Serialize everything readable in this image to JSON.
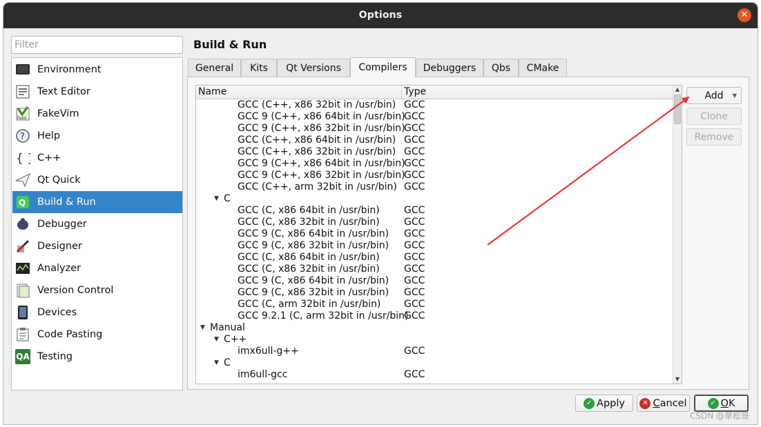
{
  "window": {
    "title": "Options",
    "close_glyph": "✕"
  },
  "filter": {
    "placeholder": "Filter",
    "value": ""
  },
  "sidebar": {
    "items": [
      {
        "label": "Environment",
        "icon": "monitor-icon",
        "active": false
      },
      {
        "label": "Text Editor",
        "icon": "text-editor-icon",
        "active": false
      },
      {
        "label": "FakeVim",
        "icon": "fakevim-icon",
        "active": false
      },
      {
        "label": "Help",
        "icon": "help-icon",
        "active": false
      },
      {
        "label": "C++",
        "icon": "cpp-braces-icon",
        "active": false
      },
      {
        "label": "Qt Quick",
        "icon": "paper-plane-icon",
        "active": false
      },
      {
        "label": "Build & Run",
        "icon": "qt-build-icon",
        "active": true
      },
      {
        "label": "Debugger",
        "icon": "bug-icon",
        "active": false
      },
      {
        "label": "Designer",
        "icon": "designer-icon",
        "active": false
      },
      {
        "label": "Analyzer",
        "icon": "analyzer-icon",
        "active": false
      },
      {
        "label": "Version Control",
        "icon": "version-control-icon",
        "active": false
      },
      {
        "label": "Devices",
        "icon": "device-icon",
        "active": false
      },
      {
        "label": "Code Pasting",
        "icon": "code-pasting-icon",
        "active": false
      },
      {
        "label": "Testing",
        "icon": "qa-icon",
        "icon_text": "QA",
        "active": false
      }
    ]
  },
  "page": {
    "title": "Build & Run"
  },
  "tabs": [
    {
      "label": "General",
      "active": false
    },
    {
      "label": "Kits",
      "active": false
    },
    {
      "label": "Qt Versions",
      "active": false
    },
    {
      "label": "Compilers",
      "active": true
    },
    {
      "label": "Debuggers",
      "active": false
    },
    {
      "label": "Qbs",
      "active": false
    },
    {
      "label": "CMake",
      "active": false
    }
  ],
  "tree": {
    "columns": {
      "name": "Name",
      "type": "Type"
    },
    "rows": [
      {
        "name": "GCC (C++, x86 32bit in /usr/bin)",
        "type": "GCC",
        "level": 2
      },
      {
        "name": "GCC 9 (C++, x86 64bit in /usr/bin)",
        "type": "GCC",
        "level": 2
      },
      {
        "name": "GCC 9 (C++, x86 32bit in /usr/bin)",
        "type": "GCC",
        "level": 2
      },
      {
        "name": "GCC (C++, x86 64bit in /usr/bin)",
        "type": "GCC",
        "level": 2
      },
      {
        "name": "GCC (C++, x86 32bit in /usr/bin)",
        "type": "GCC",
        "level": 2
      },
      {
        "name": "GCC 9 (C++, x86 64bit in /usr/bin)",
        "type": "GCC",
        "level": 2
      },
      {
        "name": "GCC 9 (C++, x86 32bit in /usr/bin)",
        "type": "GCC",
        "level": 2
      },
      {
        "name": "GCC (C++, arm 32bit in /usr/bin)",
        "type": "GCC",
        "level": 2
      },
      {
        "name": "C",
        "type": "",
        "level": 1,
        "expanded": true
      },
      {
        "name": "GCC (C, x86 64bit in /usr/bin)",
        "type": "GCC",
        "level": 2
      },
      {
        "name": "GCC (C, x86 32bit in /usr/bin)",
        "type": "GCC",
        "level": 2
      },
      {
        "name": "GCC 9 (C, x86 64bit in /usr/bin)",
        "type": "GCC",
        "level": 2
      },
      {
        "name": "GCC 9 (C, x86 32bit in /usr/bin)",
        "type": "GCC",
        "level": 2
      },
      {
        "name": "GCC (C, x86 64bit in /usr/bin)",
        "type": "GCC",
        "level": 2
      },
      {
        "name": "GCC (C, x86 32bit in /usr/bin)",
        "type": "GCC",
        "level": 2
      },
      {
        "name": "GCC 9 (C, x86 64bit in /usr/bin)",
        "type": "GCC",
        "level": 2
      },
      {
        "name": "GCC 9 (C, x86 32bit in /usr/bin)",
        "type": "GCC",
        "level": 2
      },
      {
        "name": "GCC (C, arm 32bit in /usr/bin)",
        "type": "GCC",
        "level": 2
      },
      {
        "name": "GCC 9.2.1 (C, arm 32bit in /usr/bin)",
        "type": "GCC",
        "level": 2
      },
      {
        "name": "Manual",
        "type": "",
        "level": 0,
        "expanded": true
      },
      {
        "name": "C++",
        "type": "",
        "level": 1,
        "expanded": true
      },
      {
        "name": "imx6ull-g++",
        "type": "GCC",
        "level": 2
      },
      {
        "name": "C",
        "type": "",
        "level": 1,
        "expanded": true
      },
      {
        "name": "im6ull-gcc",
        "type": "GCC",
        "level": 2
      }
    ]
  },
  "side_buttons": {
    "add": {
      "label": "Add",
      "enabled": true
    },
    "clone": {
      "label": "Clone",
      "enabled": false
    },
    "remove": {
      "label": "Remove",
      "enabled": false
    }
  },
  "dialog_buttons": {
    "apply": {
      "label": "Apply",
      "icon": "check-circle-icon"
    },
    "cancel": {
      "label_mnemonic": "C",
      "label_rest": "ancel",
      "icon": "cancel-circle-icon"
    },
    "ok": {
      "label_mnemonic": "O",
      "label_rest": "K",
      "icon": "check-circle-icon"
    }
  },
  "watermark": {
    "text": "CSDN @草松哥"
  },
  "colors": {
    "accent": "#3584c9",
    "titlebar": "#2c2c2c",
    "close": "#e95420",
    "annotation_arrow": "#ee3333",
    "ok_icon": "#2e9e3e",
    "cancel_icon": "#d02a2a"
  }
}
